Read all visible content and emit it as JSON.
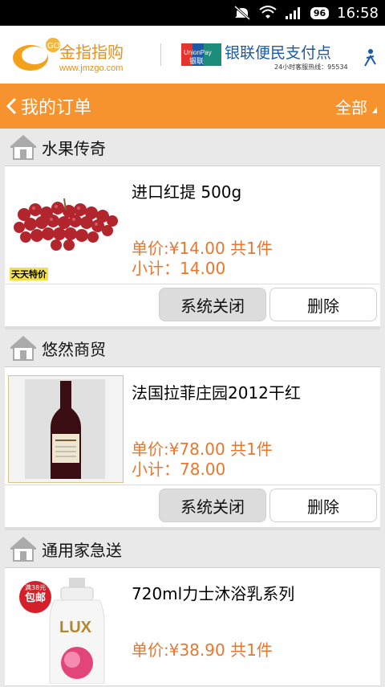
{
  "status_bar": {
    "badge": "96",
    "time": "16:58"
  },
  "banner": {
    "left_brand": "金指指购",
    "left_url": "www.jmzgo.com",
    "left_go": "GO",
    "right_brand": "银联便民支付点",
    "right_unionpay_en": "UnionPay",
    "right_unionpay_cn": "银联",
    "right_hotline": "24小时客服热线：95534"
  },
  "title_bar": {
    "title": "我的订单",
    "filter": "全部"
  },
  "orders": [
    {
      "shop": "水果传奇",
      "product": "进口红提 500g",
      "price": "单价:¥14.00  共1件",
      "subtotal": "小计：14.00",
      "thumb_tag": "天天特价",
      "actions": [
        "系统关闭",
        "删除"
      ]
    },
    {
      "shop": "悠然商贸",
      "product": "法国拉菲庄园2012干红",
      "price": "单价:¥78.00  共1件",
      "subtotal": "小计：78.00",
      "actions": [
        "系统关闭",
        "删除"
      ]
    },
    {
      "shop": "通用家急送",
      "product": "720ml力士沐浴乳系列",
      "price": "单价:¥38.90  共1件",
      "thumb_tag": "包邮",
      "thumb_tag_small": "满38元",
      "actions": []
    }
  ],
  "colors": {
    "accent": "#f7932f",
    "price": "#e8772e"
  },
  "icons": {
    "back": "chevron-left-icon",
    "filter": "triangle-down-icon",
    "shop": "house-icon"
  }
}
